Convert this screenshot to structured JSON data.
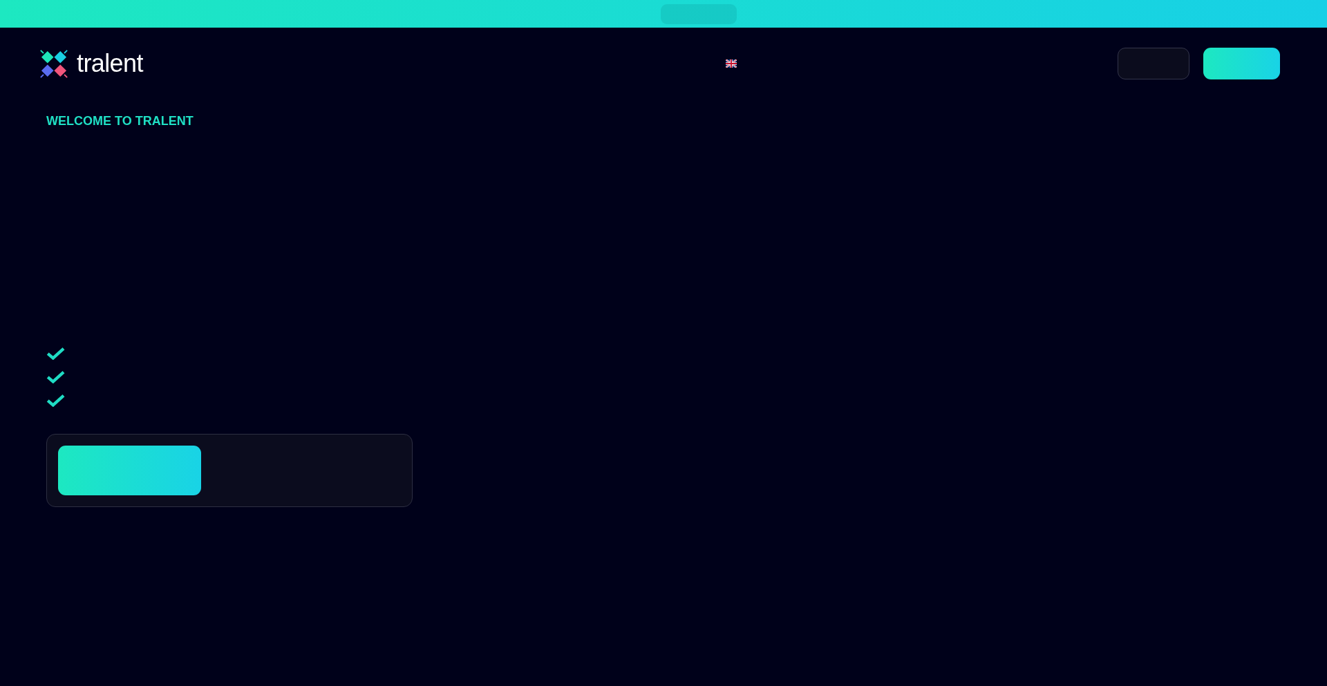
{
  "header": {
    "logo_text": "tralent"
  },
  "hero": {
    "eyebrow": "WELCOME TO TRALENT"
  }
}
